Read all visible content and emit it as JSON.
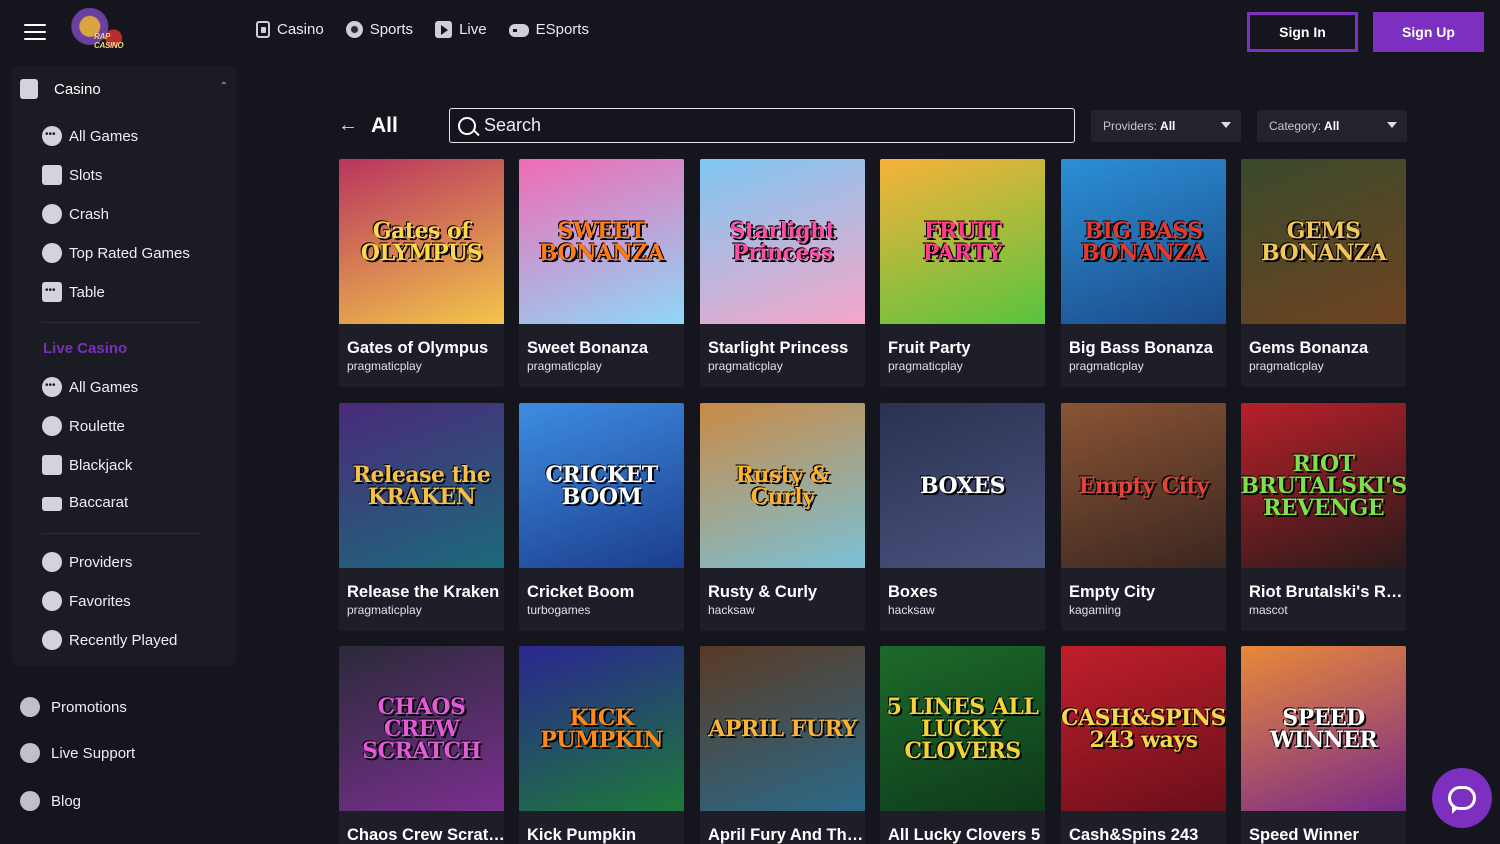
{
  "header": {
    "nav": [
      {
        "label": "Casino",
        "icon": "cards-icon"
      },
      {
        "label": "Sports",
        "icon": "ball-icon"
      },
      {
        "label": "Live",
        "icon": "play-icon"
      },
      {
        "label": "ESports",
        "icon": "gamepad-icon"
      }
    ],
    "sign_in": "Sign In",
    "sign_up": "Sign Up",
    "logo_text": "RAP CASINO"
  },
  "sidebar": {
    "casino_label": "Casino",
    "casino_items": [
      "All Games",
      "Slots",
      "Crash",
      "Top Rated Games",
      "Table"
    ],
    "live_label": "Live Casino",
    "live_items": [
      "All Games",
      "Roulette",
      "Blackjack",
      "Baccarat"
    ],
    "extra_items": [
      "Providers",
      "Favorites",
      "Recently Played"
    ],
    "bottom_items": [
      "Promotions",
      "Live Support",
      "Blog"
    ]
  },
  "main": {
    "title": "All",
    "search_placeholder": "Search",
    "providers_label": "Providers:",
    "providers_value": "All",
    "category_label": "Category:",
    "category_value": "All"
  },
  "games": [
    {
      "title": "Gates of Olympus",
      "provider": "pragmaticplay",
      "art": "Gates of OLYMPUS",
      "bg": "#b8345f",
      "bg2": "#f3c54a",
      "fg": "#ffd84a"
    },
    {
      "title": "Sweet Bonanza",
      "provider": "pragmaticplay",
      "art": "SWEET BONANZA",
      "bg": "#f06bb4",
      "bg2": "#8fd7f7",
      "fg": "#ff7a1a"
    },
    {
      "title": "Starlight Princess",
      "provider": "pragmaticplay",
      "art": "Starlight Princess",
      "bg": "#7ec7f2",
      "bg2": "#f5a6c8",
      "fg": "#ff4fa5"
    },
    {
      "title": "Fruit Party",
      "provider": "pragmaticplay",
      "art": "FRUIT PARTY",
      "bg": "#f8b23a",
      "bg2": "#57c43f",
      "fg": "#ff3a8f"
    },
    {
      "title": "Big Bass Bonanza",
      "provider": "pragmaticplay",
      "art": "BIG BASS BONANZA",
      "bg": "#2c8fd6",
      "bg2": "#1b4a88",
      "fg": "#e53a2b"
    },
    {
      "title": "Gems Bonanza",
      "provider": "pragmaticplay",
      "art": "GEMS BONANZA",
      "bg": "#3a4a2b",
      "bg2": "#6e4321",
      "fg": "#f2c65b"
    },
    {
      "title": "Release the Kraken",
      "provider": "pragmaticplay",
      "art": "Release the KRAKEN",
      "bg": "#4a2a7a",
      "bg2": "#1c6a7b",
      "fg": "#f5c04a"
    },
    {
      "title": "Cricket Boom",
      "provider": "turbogames",
      "art": "CRICKET BOOM",
      "bg": "#3d8de2",
      "bg2": "#1c3d8d",
      "fg": "#ffffff"
    },
    {
      "title": "Rusty & Curly",
      "provider": "hacksaw",
      "art": "Rusty & Curly",
      "bg": "#c98a46",
      "bg2": "#7ac1d7",
      "fg": "#ffb12c"
    },
    {
      "title": "Boxes",
      "provider": "hacksaw",
      "art": "BOXES",
      "bg": "#2b3150",
      "bg2": "#4a5380",
      "fg": "#ffffff"
    },
    {
      "title": "Empty City",
      "provider": "kagaming",
      "art": "Empty City",
      "bg": "#8a5434",
      "bg2": "#3a2620",
      "fg": "#e4433a"
    },
    {
      "title": "Riot Brutalski's Revenge",
      "provider": "mascot",
      "art": "RIOT BRUTALSKI'S REVENGE",
      "bg": "#b8202a",
      "bg2": "#2a1a1a",
      "fg": "#7ee04a"
    },
    {
      "title": "Chaos Crew Scratch",
      "provider": "",
      "art": "CHAOS CREW SCRATCH",
      "bg": "#2b2a3a",
      "bg2": "#7a2f8f",
      "fg": "#e25bd6"
    },
    {
      "title": "Kick Pumpkin",
      "provider": "",
      "art": "KICK PUMPKIN",
      "bg": "#2a2690",
      "bg2": "#1d7a3a",
      "fg": "#ff8a1a"
    },
    {
      "title": "April Fury And The Chamber of Scarabs",
      "provider": "",
      "art": "APRIL FURY",
      "bg": "#5a3a24",
      "bg2": "#2a6a8a",
      "fg": "#f7b43a"
    },
    {
      "title": "All Lucky Clovers 5",
      "provider": "",
      "art": "5 LINES ALL LUCKY CLOVERS",
      "bg": "#1c6a2a",
      "bg2": "#0f3a1a",
      "fg": "#f4d33a"
    },
    {
      "title": "Cash&Spins 243",
      "provider": "",
      "art": "CASH&SPINS 243 ways",
      "bg": "#c01f2b",
      "bg2": "#6a0f1a",
      "fg": "#f7d64a"
    },
    {
      "title": "Speed Winner",
      "provider": "",
      "art": "SPEED WINNER",
      "bg": "#e8893a",
      "bg2": "#7a2a8a",
      "fg": "#ffffff"
    }
  ],
  "colors": {
    "accent": "#7d2fbf",
    "background": "#15151d",
    "panel": "#1b1b24",
    "card": "#1e1e28"
  }
}
